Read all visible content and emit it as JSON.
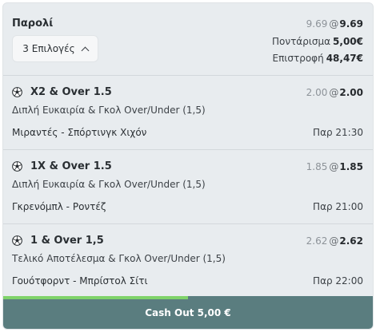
{
  "header": {
    "title": "Παρολί",
    "selections_label": "3 Επιλογές",
    "original_odds": "9.69",
    "at": "@",
    "current_odds": "9.69",
    "stake_label": "Ποντάρισμα",
    "stake_value": "5,00€",
    "return_label": "Επιστροφή",
    "return_value": "48,47€"
  },
  "selections": [
    {
      "name": "X2 & Over 1.5",
      "original_odds": "2.00",
      "at": "@",
      "current_odds": "2.00",
      "market": "Διπλή Ευκαιρία & Γκολ Over/Under (1,5)",
      "event": "Μιραντές - Σπόρτινγκ Χιχόν",
      "time": "Παρ 21:30",
      "icon": "soccer-ball-icon"
    },
    {
      "name": "1X & Over 1.5",
      "original_odds": "1.85",
      "at": "@",
      "current_odds": "1.85",
      "market": "Διπλή Ευκαιρία & Γκολ Over/Under (1,5)",
      "event": "Γκρενόμπλ - Ροντέζ",
      "time": "Παρ 21:00",
      "icon": "soccer-ball-icon"
    },
    {
      "name": "1 & Over 1,5",
      "original_odds": "2.62",
      "at": "@",
      "current_odds": "2.62",
      "market": "Τελικό Αποτέλεσμα & Γκολ Over/Under (1,5)",
      "event": "Γουότφορντ - Μπρίστολ Σίτι",
      "time": "Παρ 22:00",
      "icon": "soccer-ball-icon"
    }
  ],
  "cashout": {
    "label": "Cash Out 5,00 €",
    "progress_fraction": 0.5
  },
  "colors": {
    "card_bg": "#e8ecef",
    "cashout_bg": "#5a7d7f",
    "progress": "#7fd36a"
  }
}
